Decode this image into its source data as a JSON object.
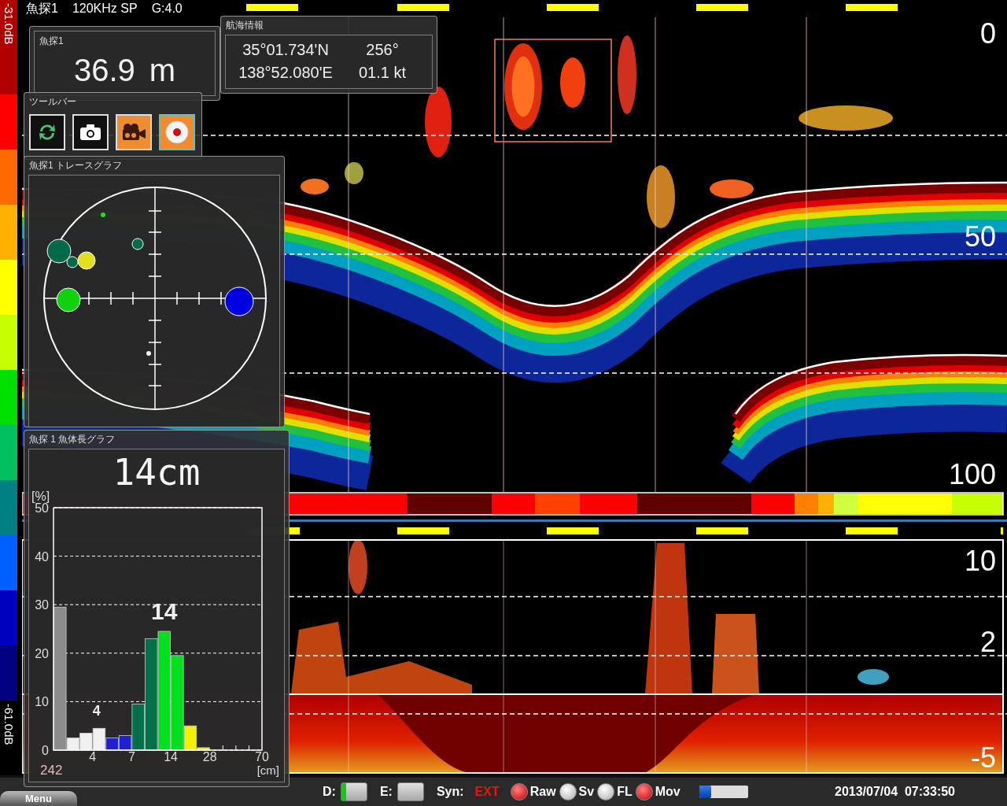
{
  "color_scale": {
    "top": "-31.0dB",
    "bottom": "-61.0dB"
  },
  "upper_view": {
    "title": "魚探1",
    "frequency": "120KHz SP",
    "gain": "G:4.0",
    "depth_labels": [
      "0",
      "50",
      "100"
    ]
  },
  "lower_view": {
    "depth_labels": [
      "10",
      "2",
      "-5"
    ]
  },
  "depth_panel": {
    "title": "魚探1",
    "value": "36.9",
    "unit": "m"
  },
  "navigation_panel": {
    "title": "航海情報",
    "latitude": "35°01.734'N",
    "heading": "256°",
    "longitude": "138°52.080'E",
    "speed": "01.1 kt"
  },
  "toolbar": {
    "title": "ツールバー",
    "buttons": [
      {
        "kind": "refresh",
        "active": false
      },
      {
        "kind": "camera",
        "active": false
      },
      {
        "kind": "video",
        "active": true
      },
      {
        "kind": "record",
        "active": true
      }
    ]
  },
  "trace_panel": {
    "title": "魚探1 トレースグラフ"
  },
  "length_panel": {
    "title": "魚探 1 魚体長グラフ",
    "mean_length": "14cm",
    "y_unit": "[%]",
    "x_unit": "[cm]",
    "count": "242",
    "chart_data": {
      "type": "bar",
      "grid": true,
      "categories": [
        null,
        null,
        "4",
        null,
        null,
        "7",
        null,
        null,
        "14",
        null,
        null,
        "28",
        null,
        null,
        null,
        "70"
      ],
      "ylim": [
        0,
        50
      ],
      "yticks": [
        0,
        10,
        20,
        30,
        40,
        50
      ],
      "series": [
        {
          "values": [
            29.5,
            2.5,
            3.5,
            4.5,
            2.5,
            3,
            9.5,
            23,
            24.5,
            19.5,
            5,
            0.5,
            null,
            null,
            null,
            null
          ],
          "colors": [
            "#8c8c8c",
            "#f0f0f0",
            "#f0f0f0",
            "#f0f0f0",
            "#2020d0",
            "#2020d0",
            "#00704a",
            "#00704a",
            "#00e020",
            "#00e020",
            "#f0f000",
            "#f0f000",
            null,
            null,
            null,
            null
          ]
        }
      ],
      "annotations": [
        "14",
        "4"
      ]
    }
  },
  "menu": {
    "label": "Menu"
  },
  "status_bar": {
    "switches": [
      {
        "label": "D:",
        "on": true
      },
      {
        "label": "E:",
        "on": false
      }
    ],
    "sync": {
      "label": "Syn:",
      "value": "EXT"
    },
    "lamps": [
      {
        "label": "Raw",
        "on": true
      },
      {
        "label": "Sv",
        "on": false
      },
      {
        "label": "FL",
        "on": false
      },
      {
        "label": "Mov",
        "on": true
      }
    ],
    "buffer": {
      "level": 0.25
    },
    "datetime": "2013/07/04  07:33:50"
  }
}
